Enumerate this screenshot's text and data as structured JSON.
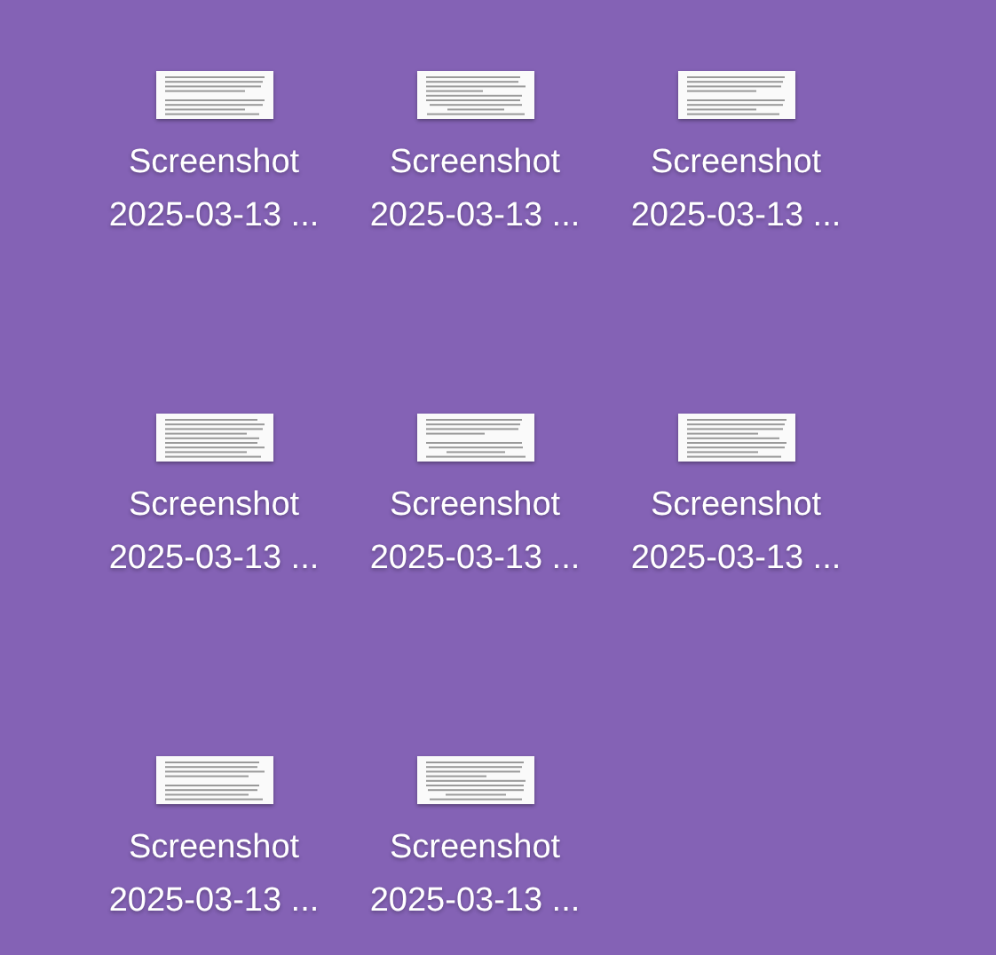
{
  "desktop": {
    "icons": [
      {
        "label": "Screenshot 2025-03-13 ..."
      },
      {
        "label": "Screenshot 2025-03-13 ..."
      },
      {
        "label": "Screenshot 2025-03-13 ..."
      },
      {
        "label": "Screenshot 2025-03-13 ..."
      },
      {
        "label": "Screenshot 2025-03-13 ..."
      },
      {
        "label": "Screenshot 2025-03-13 ..."
      },
      {
        "label": "Screenshot 2025-03-13 ..."
      },
      {
        "label": "Screenshot 2025-03-13 ..."
      }
    ]
  }
}
